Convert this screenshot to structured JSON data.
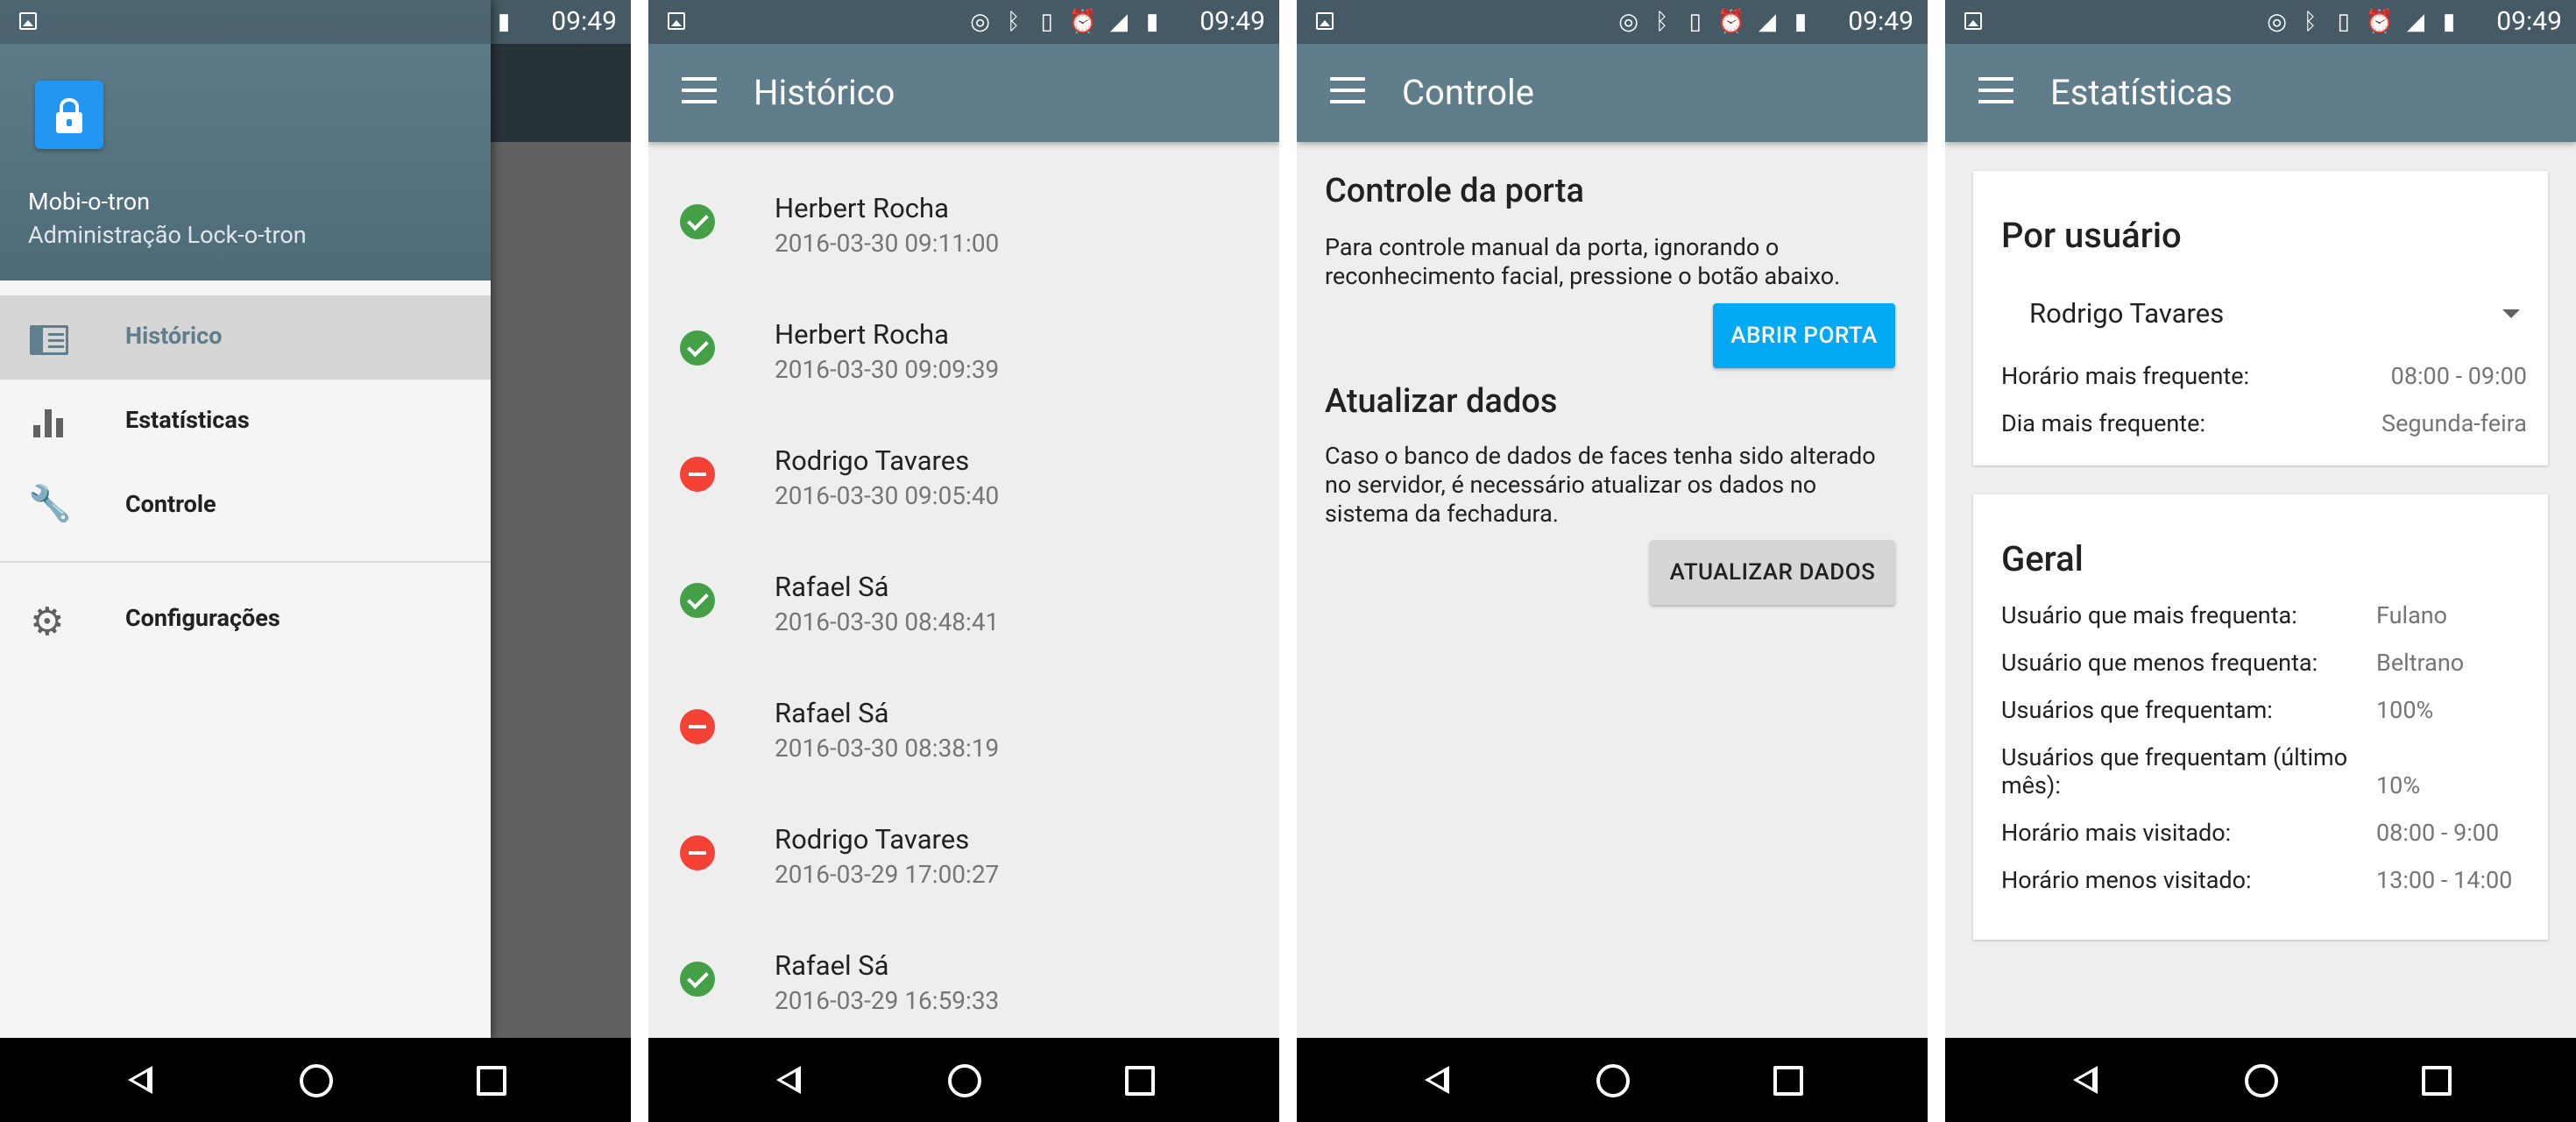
{
  "status_bar": {
    "time": "09:49",
    "icons": [
      "photo-icon",
      "hotspot-icon",
      "bluetooth-icon",
      "vibrate-icon",
      "alarm-icon",
      "signal-icon",
      "battery-icon"
    ]
  },
  "drawer_screen": {
    "app_name": "Mobi-o-tron",
    "app_subtitle": "Administração Lock-o-tron",
    "items": [
      {
        "label": "Histórico",
        "icon": "history-icon",
        "active": true
      },
      {
        "label": "Estatísticas",
        "icon": "bar-chart-icon",
        "active": false
      },
      {
        "label": "Controle",
        "icon": "wrench-icon",
        "active": false
      },
      {
        "label": "Configurações",
        "icon": "gear-icon",
        "active": false
      }
    ]
  },
  "history_screen": {
    "title": "Histórico",
    "entries": [
      {
        "name": "Herbert Rocha",
        "datetime": "2016-03-30 09:11:00",
        "status": "ok"
      },
      {
        "name": "Herbert Rocha",
        "datetime": "2016-03-30 09:09:39",
        "status": "ok"
      },
      {
        "name": "Rodrigo Tavares",
        "datetime": "2016-03-30 09:05:40",
        "status": "denied"
      },
      {
        "name": "Rafael Sá",
        "datetime": "2016-03-30 08:48:41",
        "status": "ok"
      },
      {
        "name": "Rafael Sá",
        "datetime": "2016-03-30 08:38:19",
        "status": "denied"
      },
      {
        "name": "Rodrigo Tavares",
        "datetime": "2016-03-29 17:00:27",
        "status": "denied"
      },
      {
        "name": "Rafael Sá",
        "datetime": "2016-03-29 16:59:33",
        "status": "ok"
      }
    ]
  },
  "control_screen": {
    "title": "Controle",
    "door_heading": "Controle da porta",
    "door_text_line1": "Para controle manual da porta, ignorando o",
    "door_text_line2": "reconhecimento facial, pressione o botão abaixo.",
    "open_button": "ABRIR PORTA",
    "update_heading": "Atualizar dados",
    "update_text_line1": "Caso o banco de dados de faces tenha sido alterado",
    "update_text_line2": "no servidor, é necessário atualizar os dados no",
    "update_text_line3": "sistema da fechadura.",
    "update_button": "ATUALIZAR DADOS"
  },
  "stats_screen": {
    "title": "Estatísticas",
    "per_user": {
      "heading": "Por usuário",
      "selected_user": "Rodrigo Tavares",
      "rows": [
        {
          "label": "Horário mais frequente:",
          "value": "08:00 - 09:00"
        },
        {
          "label": "Dia mais frequente:",
          "value": "Segunda-feira"
        }
      ]
    },
    "general": {
      "heading": "Geral",
      "rows": [
        {
          "label": "Usuário que mais frequenta:",
          "value": "Fulano"
        },
        {
          "label": "Usuário que menos frequenta:",
          "value": "Beltrano"
        },
        {
          "label": "Usuários que frequentam:",
          "value": "100%"
        },
        {
          "label_line1": "Usuários que frequentam (último",
          "label_line2": "mês):",
          "value": "10%"
        },
        {
          "label": "Horário mais visitado:",
          "value": "08:00 - 9:00"
        },
        {
          "label": "Horário menos visitado:",
          "value": "13:00 - 14:00"
        }
      ]
    }
  }
}
